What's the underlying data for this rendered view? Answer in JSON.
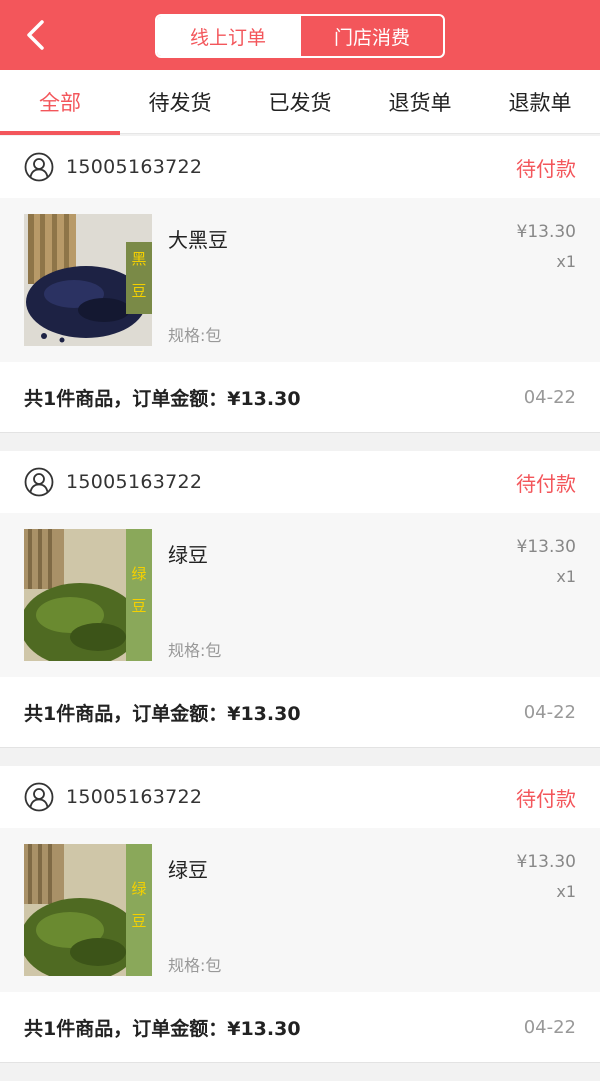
{
  "header": {
    "tabs": [
      {
        "label": "线上订单",
        "active": true
      },
      {
        "label": "门店消费",
        "active": false
      }
    ],
    "back_icon": "chevron-left-icon"
  },
  "filter_tabs": [
    {
      "label": "全部",
      "active": true
    },
    {
      "label": "待发货",
      "active": false
    },
    {
      "label": "已发货",
      "active": false
    },
    {
      "label": "退货单",
      "active": false
    },
    {
      "label": "退款单",
      "active": false
    }
  ],
  "orders": [
    {
      "phone": "15005163722",
      "status": "待付款",
      "item": {
        "name": "大黑豆",
        "spec": "规格:包",
        "price": "¥13.30",
        "qty": "x1",
        "thumb_label": "黑豆"
      },
      "summary": "共1件商品，订单金额：¥13.30",
      "date": "04-22"
    },
    {
      "phone": "15005163722",
      "status": "待付款",
      "item": {
        "name": "绿豆",
        "spec": "规格:包",
        "price": "¥13.30",
        "qty": "x1",
        "thumb_label": "绿豆"
      },
      "summary": "共1件商品，订单金额：¥13.30",
      "date": "04-22"
    },
    {
      "phone": "15005163722",
      "status": "待付款",
      "item": {
        "name": "绿豆",
        "spec": "规格:包",
        "price": "¥13.30",
        "qty": "x1",
        "thumb_label": "绿豆"
      },
      "summary": "共1件商品，订单金额：¥13.30",
      "date": "04-22"
    }
  ],
  "colors": {
    "accent": "#f3565b",
    "background": "#f2f2f2"
  }
}
